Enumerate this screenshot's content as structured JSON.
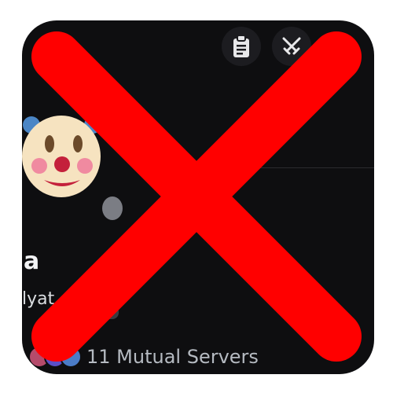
{
  "profile": {
    "display_name": "a",
    "username": "lyat",
    "mutual_servers_label": "11 Mutual Servers"
  },
  "actions": {
    "copy_icon": "clipboard-icon",
    "swords_icon": "crossed-swords-icon"
  },
  "avatar": {
    "icon": "clown-face-icon"
  },
  "colors": {
    "panel_bg": "#0e0e10",
    "overlay_x": "#ff0000",
    "status_offline": "#7b7d84"
  }
}
